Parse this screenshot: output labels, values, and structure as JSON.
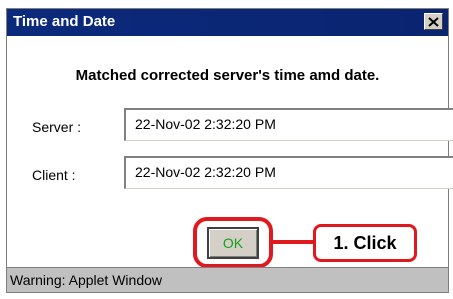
{
  "window": {
    "title": "Time and Date",
    "close_glyph": "close-icon"
  },
  "message": "Matched corrected server's time amd date.",
  "fields": {
    "server_label": "Server :",
    "server_value": "22-Nov-02 2:32:20 PM",
    "client_label": "Client :",
    "client_value": "22-Nov-02 2:32:20 PM"
  },
  "buttons": {
    "ok_label": "OK"
  },
  "annotation": {
    "callout_text": "1. Click",
    "accent_color": "#e0191f"
  },
  "statusbar": {
    "text": "Warning: Applet Window"
  },
  "colors": {
    "titlebar": "#0a2470",
    "ok_text": "#18a018",
    "statusbar": "#c0c0c0"
  }
}
